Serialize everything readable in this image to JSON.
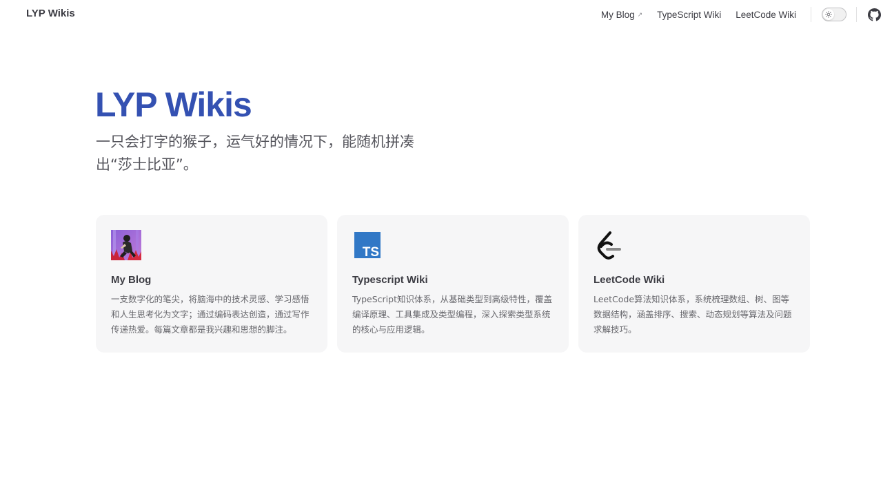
{
  "nav": {
    "site_title": "LYP Wikis",
    "links": [
      {
        "label": "My Blog",
        "external_mark": "↗"
      },
      {
        "label": "TypeScript Wiki"
      },
      {
        "label": "LeetCode Wiki"
      }
    ],
    "theme_icon": "sun-icon",
    "social_icon": "github-icon"
  },
  "hero": {
    "name": "LYP Wikis",
    "tagline": "一只会打字的猴子，运气好的情况下，能随机拼凑出“莎士比亚”。"
  },
  "features": [
    {
      "icon": "blog-avatar-image",
      "title": "My Blog",
      "details": "一支数字化的笔尖，将脑海中的技术灵感、学习感悟和人生思考化为文字；通过编码表达创造，通过写作传递热爱。每篇文章都是我兴趣和思想的脚注。"
    },
    {
      "icon": "typescript-icon",
      "icon_text": "TS",
      "title": "Typescript Wiki",
      "details": "TypeScript知识体系，从基础类型到高级特性，覆盖编译原理、工具集成及类型编程，深入探索类型系统的核心与应用逻辑。"
    },
    {
      "icon": "leetcode-icon",
      "title": "LeetCode Wiki",
      "details": "LeetCode算法知识体系，系统梳理数组、树、图等数据结构，涵盖排序、搜索、动态规划等算法及问题求解技巧。"
    }
  ],
  "colors": {
    "brand": "#3451b2",
    "card_bg": "#f6f6f7",
    "typescript_blue": "#3178c6"
  }
}
